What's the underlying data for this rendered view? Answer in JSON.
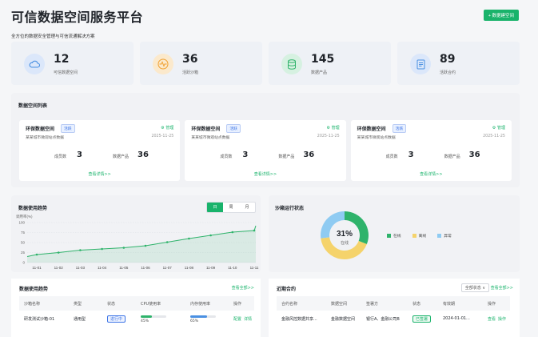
{
  "header": {
    "title": "可信数据空间服务平台",
    "subtitle": "全方位的数据安全管理与可信流通解决方案",
    "create_button": "+ 数据建空间"
  },
  "stats": [
    {
      "value": "12",
      "label": "可信数据空间",
      "icon": "cloud-icon",
      "color": "#4a90e2",
      "bg": "#dbe7fa"
    },
    {
      "value": "36",
      "label": "活跃沙箱",
      "icon": "pulse-icon",
      "color": "#f0a030",
      "bg": "#fbe9cc"
    },
    {
      "value": "145",
      "label": "数据产品",
      "icon": "database-icon",
      "color": "#2fb36b",
      "bg": "#d6f1e1"
    },
    {
      "value": "89",
      "label": "活跃合约",
      "icon": "document-icon",
      "color": "#4a90e2",
      "bg": "#dbe7fa"
    }
  ],
  "space_list": {
    "title": "数据空间列表",
    "cards": [
      {
        "name": "环保数据空间",
        "tag": "活跃",
        "manage": "⚙ 管理",
        "desc": "某某城市微观站点数据",
        "date": "2025-11-25",
        "m1_label": "成员数",
        "m1_value": "3",
        "m2_label": "数据产品",
        "m2_value": "36",
        "more": "查看详情>>"
      },
      {
        "name": "环保数据空间",
        "tag": "活跃",
        "manage": "⚙ 管理",
        "desc": "某某城市微观站点数据",
        "date": "2025-11-25",
        "m1_label": "成员数",
        "m1_value": "3",
        "m2_label": "数据产品",
        "m2_value": "36",
        "more": "查看详情>>"
      },
      {
        "name": "环保数据空间",
        "tag": "活跃",
        "manage": "⚙ 管理",
        "desc": "某某城市微观站点数据",
        "date": "2025-11-25",
        "m1_label": "成员数",
        "m1_value": "3",
        "m2_label": "数据产品",
        "m2_value": "36",
        "more": "查看详情>>"
      }
    ]
  },
  "trend": {
    "title": "数据使用趋势",
    "tabs": [
      "日",
      "周",
      "月"
    ],
    "active_tab": 0
  },
  "sandbox": {
    "title": "沙箱运行状态",
    "center_value": "31%",
    "center_label": "在线"
  },
  "chart_data": [
    {
      "type": "area",
      "ylabel": "调用率(%)",
      "x": [
        "11-01",
        "11-02",
        "11-03",
        "11-04",
        "11-05",
        "11-06",
        "11-07",
        "11-08",
        "11-09",
        "11-10",
        "11-11"
      ],
      "y": [
        20,
        25,
        31,
        34,
        37,
        42,
        51,
        60,
        68,
        76,
        80
      ],
      "y_start": 15,
      "y_end": 92,
      "yticks": [
        0,
        25,
        50,
        75,
        100
      ],
      "ylim": [
        0,
        100
      ],
      "color": "#2fb36b"
    },
    {
      "type": "pie",
      "labels": [
        "在线",
        "离线",
        "异常"
      ],
      "values": [
        31,
        42,
        27
      ],
      "colors": [
        "#2fb36b",
        "#f5d36b",
        "#8fcbf2"
      ]
    }
  ],
  "sandbox_table": {
    "title": "数据使用趋势",
    "all_link": "查看全部>>",
    "columns": [
      "沙箱名称",
      "类型",
      "状态",
      "CPU使用率",
      "内存使用率",
      "操作"
    ],
    "rows": [
      {
        "name": "研发测试沙箱-01",
        "type": "通用型",
        "status": "进行中",
        "cpu": "45%",
        "cpu_color": "#2fb36b",
        "mem": "65%",
        "mem_color": "#4a90e2",
        "op1": "配置",
        "op2": "详情"
      }
    ]
  },
  "contract_table": {
    "title": "近期合约",
    "filter": "全部状态 ∨",
    "all_link": "查看全部>>",
    "columns": [
      "合约名称",
      "数据空间",
      "签署方",
      "状态",
      "有效期",
      "操作"
    ],
    "rows": [
      {
        "name": "金融风控数据共享...",
        "space": "金融数据空间",
        "party": "银行A、金融公司B",
        "status": "已签署",
        "expiry": "2024-01-01...",
        "op1": "查看",
        "op2": "操作"
      }
    ]
  }
}
